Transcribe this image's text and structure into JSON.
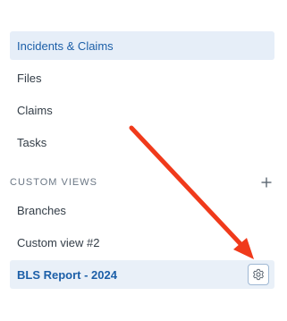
{
  "sidebar": {
    "items": [
      {
        "label": "Incidents & Claims"
      },
      {
        "label": "Files"
      },
      {
        "label": "Claims"
      },
      {
        "label": "Tasks"
      }
    ],
    "custom_views": {
      "title": "CUSTOM VIEWS",
      "items": [
        {
          "label": "Branches"
        },
        {
          "label": "Custom view #2"
        },
        {
          "label": "BLS Report - 2024"
        }
      ]
    }
  },
  "icons": {
    "add": "plus-icon",
    "settings": "gear-icon",
    "annotation": "red-arrow"
  },
  "colors": {
    "active_bg": "#e6eef8",
    "active_text": "#1c5fa8",
    "arrow": "#f03a1b"
  }
}
